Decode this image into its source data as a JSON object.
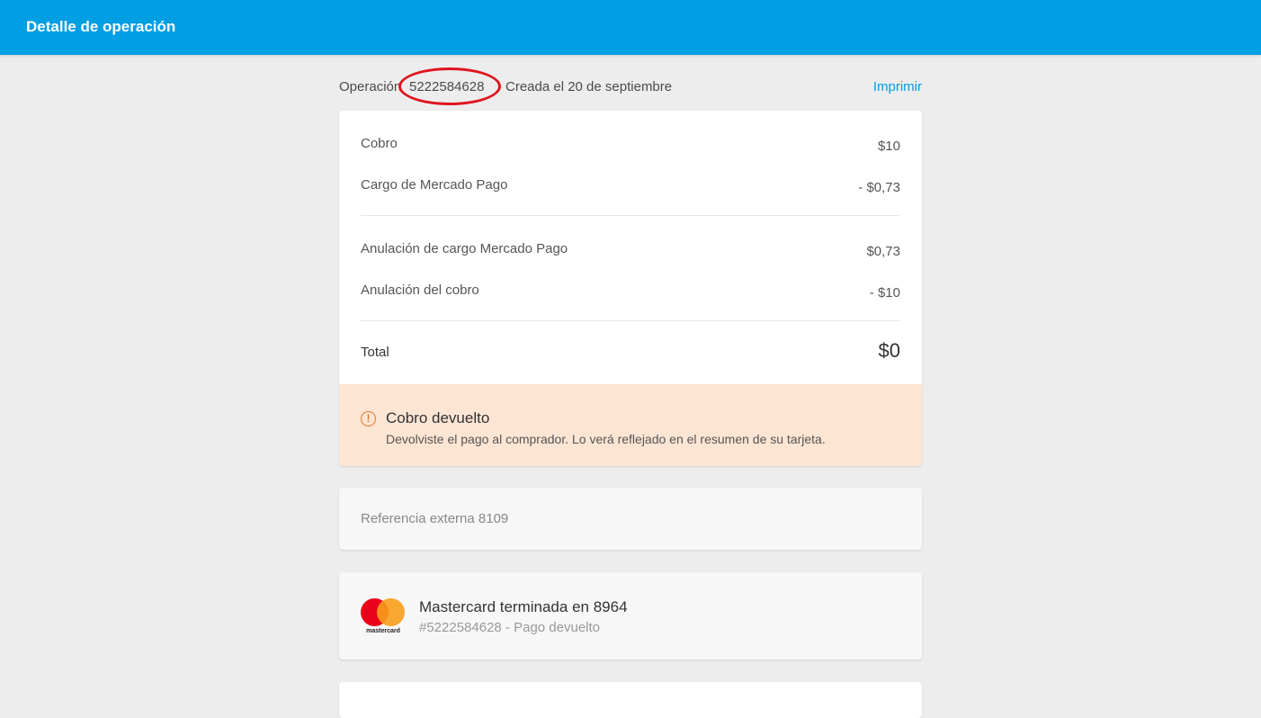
{
  "header": {
    "title": "Detalle de operación",
    "bar_color": "#009ee3"
  },
  "operation": {
    "label": "Operación",
    "number": "5222584628",
    "created": "Creada el 20 de septiembre",
    "print_label": "Imprimir"
  },
  "summary": {
    "rows": [
      {
        "label": "Cobro",
        "amount": "$10"
      },
      {
        "label": "Cargo de Mercado Pago",
        "amount": "- $0,73"
      },
      {
        "label": "Anulación de cargo Mercado Pago",
        "amount": "$0,73"
      },
      {
        "label": "Anulación del cobro",
        "amount": "- $10"
      }
    ],
    "total_label": "Total",
    "total_amount": "$0"
  },
  "alert": {
    "icon": "warning-circle-icon",
    "icon_glyph": "!",
    "title": "Cobro devuelto",
    "text": "Devolviste el pago al comprador. Lo verá reflejado en el resumen de su tarjeta.",
    "background": "#fde5d4",
    "accent": "#e27a2a"
  },
  "reference": {
    "text": "Referencia externa 8109"
  },
  "payment_method": {
    "logo_text": "mastercard",
    "title": "Mastercard terminada en 8964",
    "subtitle": "#5222584628  - Pago devuelto"
  },
  "annotation": {
    "color": "#e0141e"
  }
}
